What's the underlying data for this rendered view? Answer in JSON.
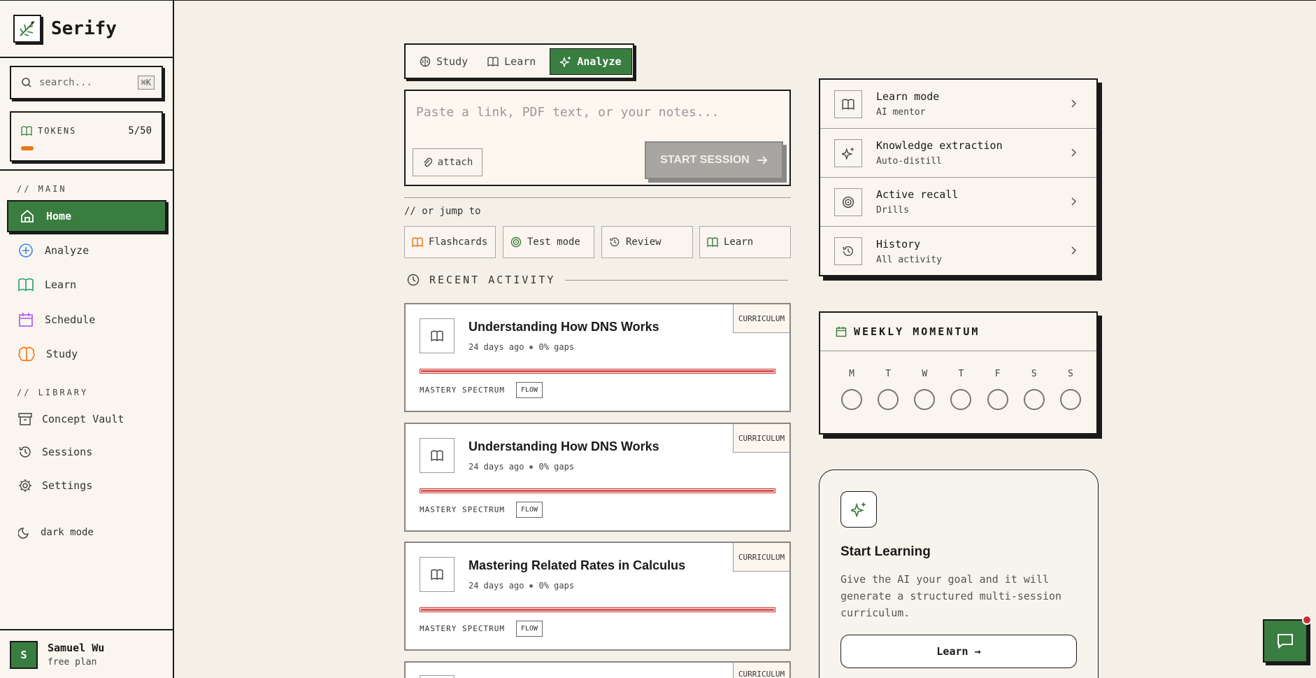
{
  "brand": {
    "name": "Serify"
  },
  "search": {
    "placeholder": "search...",
    "shortcut": "⌘K"
  },
  "tokens": {
    "label": "TOKENS",
    "count": "5/50",
    "used": 5,
    "total": 50,
    "color": "#e8751a"
  },
  "sidebar": {
    "main_label": "// MAIN",
    "main_items": [
      {
        "label": "Home",
        "icon": "home-icon",
        "active": true
      },
      {
        "label": "Analyze",
        "icon": "plus-circle-icon",
        "color": "#3b82f6"
      },
      {
        "label": "Learn",
        "icon": "book-icon",
        "color": "#22a06b"
      },
      {
        "label": "Schedule",
        "icon": "calendar-icon",
        "color": "#a855f7"
      },
      {
        "label": "Study",
        "icon": "brain-icon",
        "color": "#f97316"
      }
    ],
    "library_label": "// LIBRARY",
    "library_items": [
      {
        "label": "Concept Vault",
        "icon": "archive-icon"
      },
      {
        "label": "Sessions",
        "icon": "history-icon"
      },
      {
        "label": "Settings",
        "icon": "gear-icon"
      }
    ],
    "dark_mode": "dark mode"
  },
  "user": {
    "initial": "S",
    "name": "Samuel Wu",
    "plan": "free plan"
  },
  "mode_tabs": [
    {
      "label": "Study",
      "icon": "brain-icon"
    },
    {
      "label": "Learn",
      "icon": "book-icon"
    },
    {
      "label": "Analyze",
      "icon": "sparkles-icon",
      "active": true
    }
  ],
  "composer": {
    "placeholder": "Paste a link, PDF text, or your notes...",
    "attach": "attach",
    "start": "START SESSION"
  },
  "jump": {
    "label": "// or jump to",
    "items": [
      {
        "label": "Flashcards",
        "icon": "book-icon",
        "color": "#e8751a"
      },
      {
        "label": "Test mode",
        "icon": "target-icon",
        "color": "#3a7d40"
      },
      {
        "label": "Review",
        "icon": "history-icon",
        "color": "#555555"
      },
      {
        "label": "Learn",
        "icon": "book-icon",
        "color": "#3a7d40"
      }
    ]
  },
  "recent": {
    "title": "RECENT ACTIVITY",
    "items": [
      {
        "title": "Understanding How DNS Works",
        "time": "24 days ago",
        "gaps": "0% gaps",
        "badge": "CURRICULUM",
        "mastery": "MASTERY SPECTRUM",
        "tag": "FLOW"
      },
      {
        "title": "Understanding How DNS Works",
        "time": "24 days ago",
        "gaps": "0% gaps",
        "badge": "CURRICULUM",
        "mastery": "MASTERY SPECTRUM",
        "tag": "FLOW"
      },
      {
        "title": "Mastering Related Rates in Calculus",
        "time": "24 days ago",
        "gaps": "0% gaps",
        "badge": "CURRICULUM",
        "mastery": "MASTERY SPECTRUM",
        "tag": "FLOW"
      },
      {
        "badge": "CURRICULUM"
      }
    ]
  },
  "modes": [
    {
      "title": "Learn mode",
      "sub": "AI mentor",
      "icon": "book-icon"
    },
    {
      "title": "Knowledge extraction",
      "sub": "Auto-distill",
      "icon": "sparkles-icon"
    },
    {
      "title": "Active recall",
      "sub": "Drills",
      "icon": "target-icon"
    },
    {
      "title": "History",
      "sub": "All activity",
      "icon": "history-icon"
    }
  ],
  "weekly": {
    "title": "WEEKLY MOMENTUM",
    "days": [
      "M",
      "T",
      "W",
      "T",
      "F",
      "S",
      "S"
    ]
  },
  "start_card": {
    "title": "Start Learning",
    "desc": "Give the AI your goal and it will generate a structured multi-session curriculum.",
    "button": "Learn →"
  },
  "colors": {
    "accent": "#3a7d40",
    "danger": "#d9534f",
    "bg": "#f4f0e8"
  }
}
